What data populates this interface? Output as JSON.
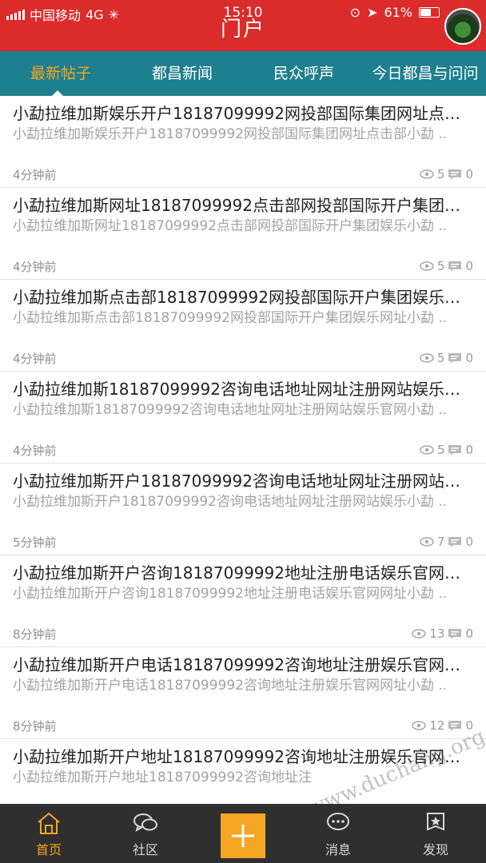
{
  "status_bar": {
    "carrier": "中国移动",
    "network": "4G",
    "time": "15:10",
    "battery": "61%"
  },
  "header": {
    "title": "门户"
  },
  "tabs": [
    {
      "label": "最新帖子",
      "active": true
    },
    {
      "label": "都昌新闻",
      "active": false
    },
    {
      "label": "民众呼声",
      "active": false
    },
    {
      "label": "今日都昌与问问",
      "active": false
    }
  ],
  "posts": [
    {
      "title": "小勐拉维加斯娱乐开户18187099992网投部国际集团网址点击部小勐",
      "summary": "小勐拉维加斯娱乐开户18187099992网投部国际集团网址点击部小勐 ..",
      "time": "4分钟前",
      "views": "5",
      "comments": "0"
    },
    {
      "title": "小勐拉维加斯网址18187099992点击部网投部国际开户集团娱乐小勐",
      "summary": "小勐拉维加斯网址18187099992点击部网投部国际开户集团娱乐小勐 ..",
      "time": "4分钟前",
      "views": "5",
      "comments": "0"
    },
    {
      "title": "小勐拉维加斯点击部18187099992网投部国际开户集团娱乐网址小勐",
      "summary": "小勐拉维加斯点击部18187099992网投部国际开户集团娱乐网址小勐 ..",
      "time": "4分钟前",
      "views": "5",
      "comments": "0"
    },
    {
      "title": "小勐拉维加斯18187099992咨询电话地址网址注册网站娱乐官网小勐",
      "summary": "小勐拉维加斯18187099992咨询电话地址网址注册网站娱乐官网小勐 ..",
      "time": "4分钟前",
      "views": "5",
      "comments": "0"
    },
    {
      "title": "小勐拉维加斯开户18187099992咨询电话地址网址注册网站娱乐小勐",
      "summary": "小勐拉维加斯开户18187099992咨询电话地址网址注册网站娱乐小勐 ..",
      "time": "5分钟前",
      "views": "7",
      "comments": "0"
    },
    {
      "title": "小勐拉维加斯开户咨询18187099992地址注册电话娱乐官网网址小勐",
      "summary": "小勐拉维加斯开户咨询18187099992地址注册电话娱乐官网网址小勐 ..",
      "time": "8分钟前",
      "views": "13",
      "comments": "0"
    },
    {
      "title": "小勐拉维加斯开户电话18187099992咨询地址注册娱乐官网网址小勐",
      "summary": "小勐拉维加斯开户电话18187099992咨询地址注册娱乐官网网址小勐 ..",
      "time": "8分钟前",
      "views": "12",
      "comments": "0"
    },
    {
      "title": "小勐拉维加斯开户地址18187099992咨询地址注册娱乐官网网址小勐",
      "summary": "小勐拉维加斯开户地址18187099992咨询地址注",
      "time": "",
      "views": "",
      "comments": ""
    }
  ],
  "bottom_nav": [
    {
      "label": "首页",
      "icon": "home-icon",
      "active": true
    },
    {
      "label": "社区",
      "icon": "chat-bubbles-icon",
      "active": false
    },
    {
      "label": "",
      "icon": "plus-icon",
      "active": false
    },
    {
      "label": "消息",
      "icon": "message-icon",
      "active": false
    },
    {
      "label": "发现",
      "icon": "discover-flag-icon",
      "active": false
    }
  ],
  "colors": {
    "header_red": "#db2b2b",
    "tab_teal": "#1e7f8e",
    "accent_orange": "#f5a623",
    "nav_dark": "#2f2f2f"
  },
  "watermark": "www.duchang.org"
}
